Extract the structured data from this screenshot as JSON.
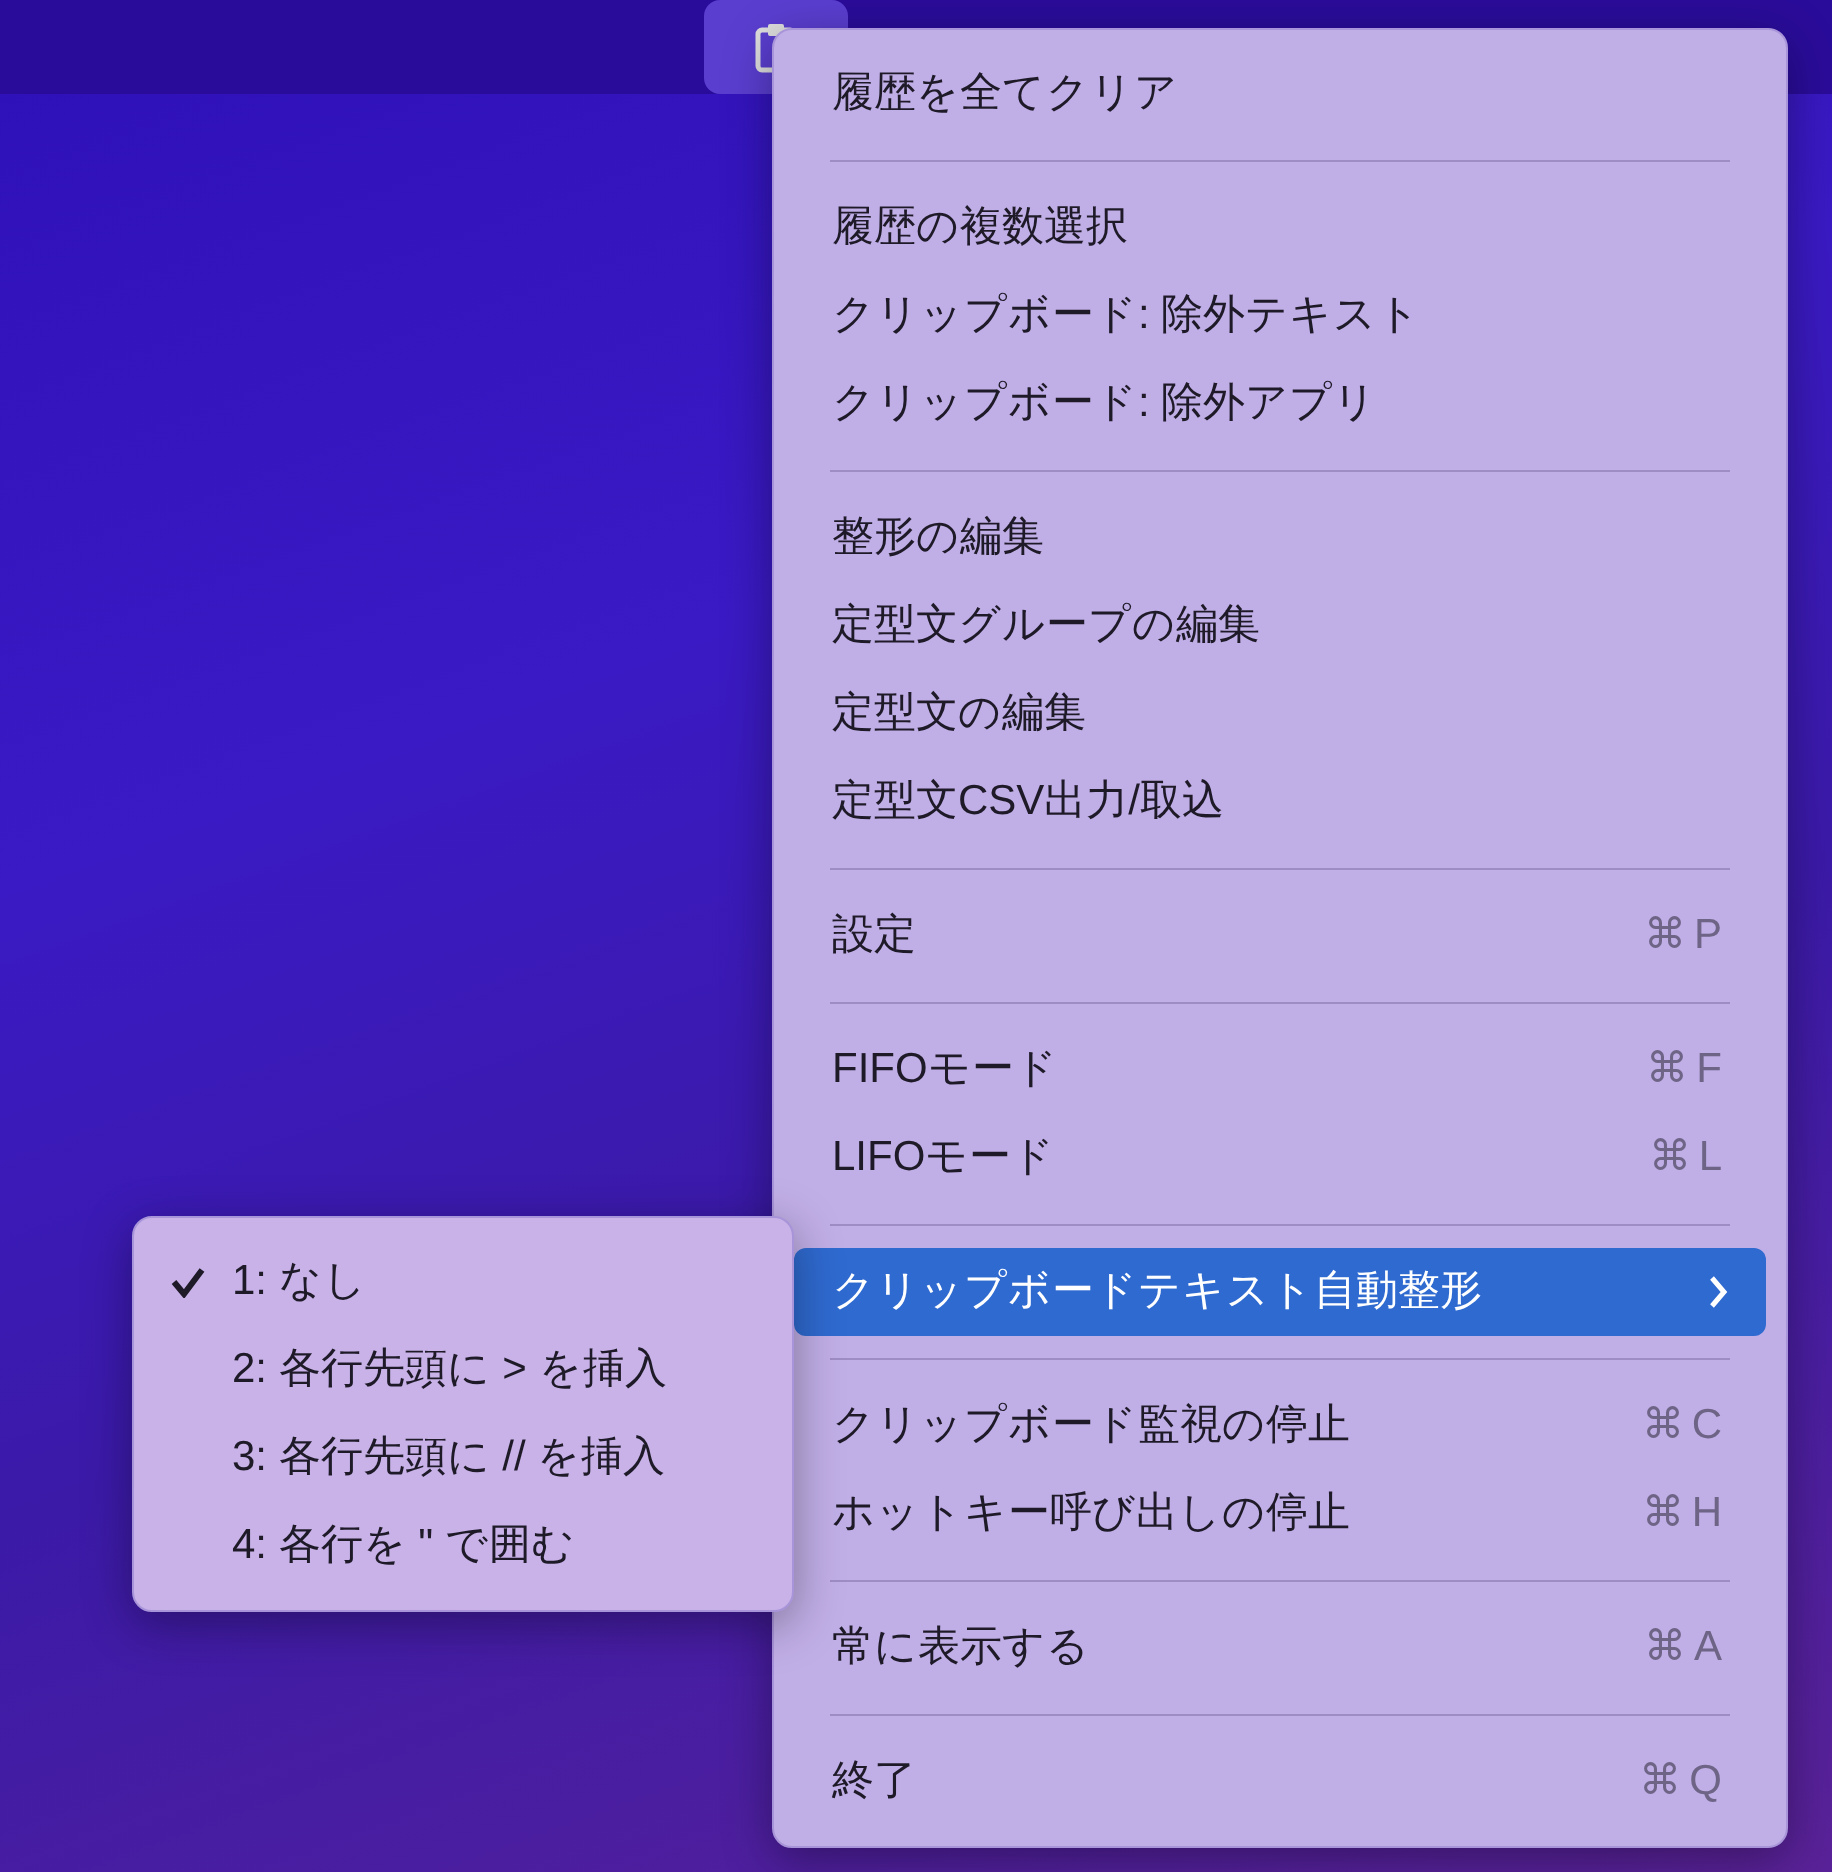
{
  "menu": {
    "items": [
      {
        "kind": "item",
        "label": "履歴を全てクリア",
        "selected": false
      },
      {
        "kind": "separator"
      },
      {
        "kind": "item",
        "label": "履歴の複数選択",
        "selected": false
      },
      {
        "kind": "item",
        "label": "クリップボード: 除外テキスト",
        "selected": false
      },
      {
        "kind": "item",
        "label": "クリップボード: 除外アプリ",
        "selected": false
      },
      {
        "kind": "separator"
      },
      {
        "kind": "item",
        "label": "整形の編集",
        "selected": false
      },
      {
        "kind": "item",
        "label": "定型文グループの編集",
        "selected": false
      },
      {
        "kind": "item",
        "label": "定型文の編集",
        "selected": false
      },
      {
        "kind": "item",
        "label": "定型文CSV出力/取込",
        "selected": false
      },
      {
        "kind": "separator"
      },
      {
        "kind": "item",
        "label": "設定",
        "shortcut": "⌘P",
        "selected": false
      },
      {
        "kind": "separator"
      },
      {
        "kind": "item",
        "label": "FIFOモード",
        "shortcut": "⌘F",
        "selected": false
      },
      {
        "kind": "item",
        "label": "LIFOモード",
        "shortcut": "⌘L",
        "selected": false
      },
      {
        "kind": "separator"
      },
      {
        "kind": "submenu",
        "label": "クリップボードテキスト自動整形",
        "selected": true
      },
      {
        "kind": "separator"
      },
      {
        "kind": "item",
        "label": "クリップボード監視の停止",
        "shortcut": "⌘C",
        "selected": false
      },
      {
        "kind": "item",
        "label": "ホットキー呼び出しの停止",
        "shortcut": "⌘H",
        "selected": false
      },
      {
        "kind": "separator"
      },
      {
        "kind": "item",
        "label": "常に表示する",
        "shortcut": "⌘A",
        "selected": false
      },
      {
        "kind": "separator"
      },
      {
        "kind": "item",
        "label": "終了",
        "shortcut": "⌘Q",
        "selected": false
      }
    ]
  },
  "submenu": {
    "items": [
      {
        "label": "1: なし",
        "checked": true
      },
      {
        "label": "2: 各行先頭に > を挿入",
        "checked": false
      },
      {
        "label": "3: 各行先頭に // を挿入",
        "checked": false
      },
      {
        "label": "4: 各行を \" で囲む",
        "checked": false
      }
    ]
  }
}
